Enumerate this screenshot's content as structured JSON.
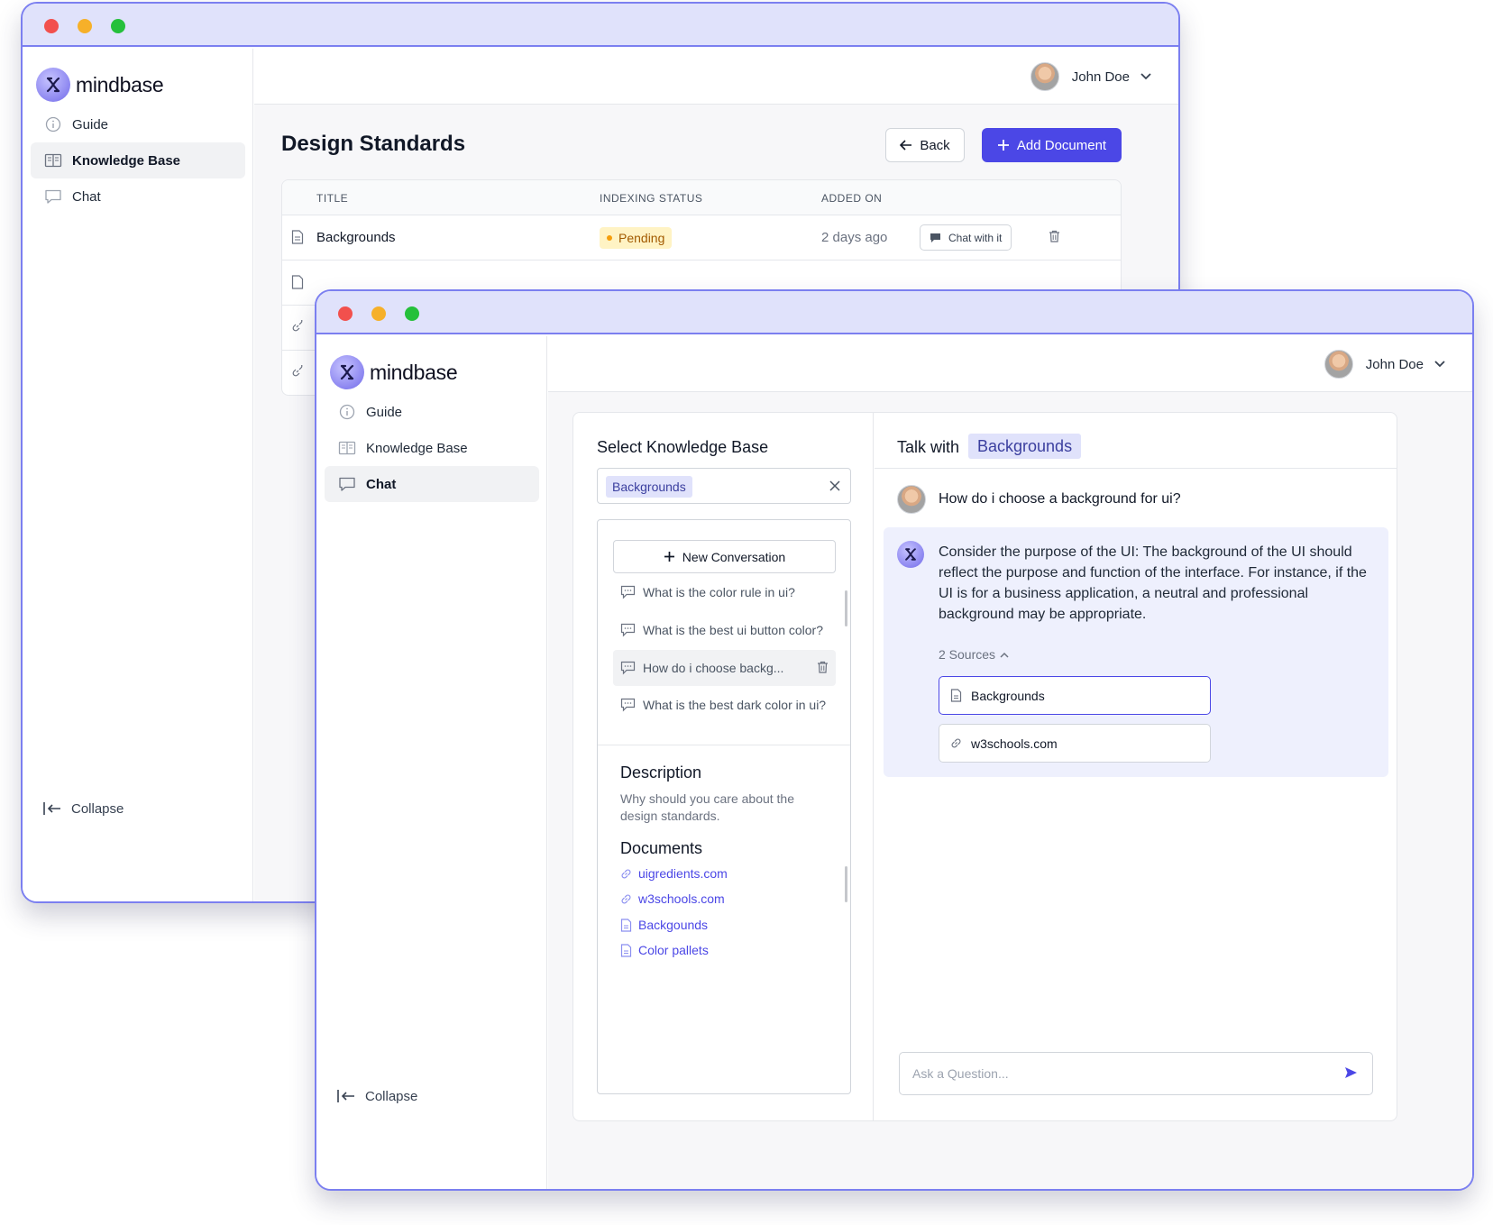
{
  "app": {
    "name": "mindbase"
  },
  "user": {
    "name": "John Doe"
  },
  "nav": {
    "guide": "Guide",
    "knowledge_base": "Knowledge Base",
    "chat": "Chat",
    "collapse": "Collapse"
  },
  "kb_window": {
    "page_title": "Design Standards",
    "back_label": "Back",
    "add_label": "Add Document",
    "columns": {
      "title": "TITLE",
      "status": "INDEXING STATUS",
      "added": "ADDED ON"
    },
    "rows": [
      {
        "title": "Backgrounds",
        "status": "Pending",
        "added": "2 days ago",
        "action": "Chat with it"
      }
    ]
  },
  "chat_window": {
    "select_title": "Select Knowledge Base",
    "selected_kb": "Backgrounds",
    "new_conversation": "New Conversation",
    "conversations": [
      "What is the color rule in ui?",
      "What is the best ui button color?",
      "How do i choose backg...",
      "What is the best dark color in ui?"
    ],
    "description_title": "Description",
    "description_text": "Why should you care about the design standards.",
    "documents_title": "Documents",
    "documents": [
      "uigredients.com",
      "w3schools.com",
      "Backgounds",
      "Color pallets"
    ],
    "talk_label": "Talk with",
    "talk_kb": "Backgrounds",
    "question": "How do i choose a background for ui?",
    "answer": "Consider the purpose of the UI: The background of the UI should reflect the purpose and function of the interface. For instance, if the UI is for a business application, a neutral and professional background may be appropriate.",
    "sources_label": "2 Sources",
    "sources": [
      "Backgrounds",
      "w3schools.com"
    ],
    "ask_placeholder": "Ask a Question..."
  },
  "colors": {
    "accent": "#4b47e6",
    "window_border": "#7b7ff0",
    "titlebar": "#e0e2fb",
    "pending_bg": "#fff3c4"
  }
}
